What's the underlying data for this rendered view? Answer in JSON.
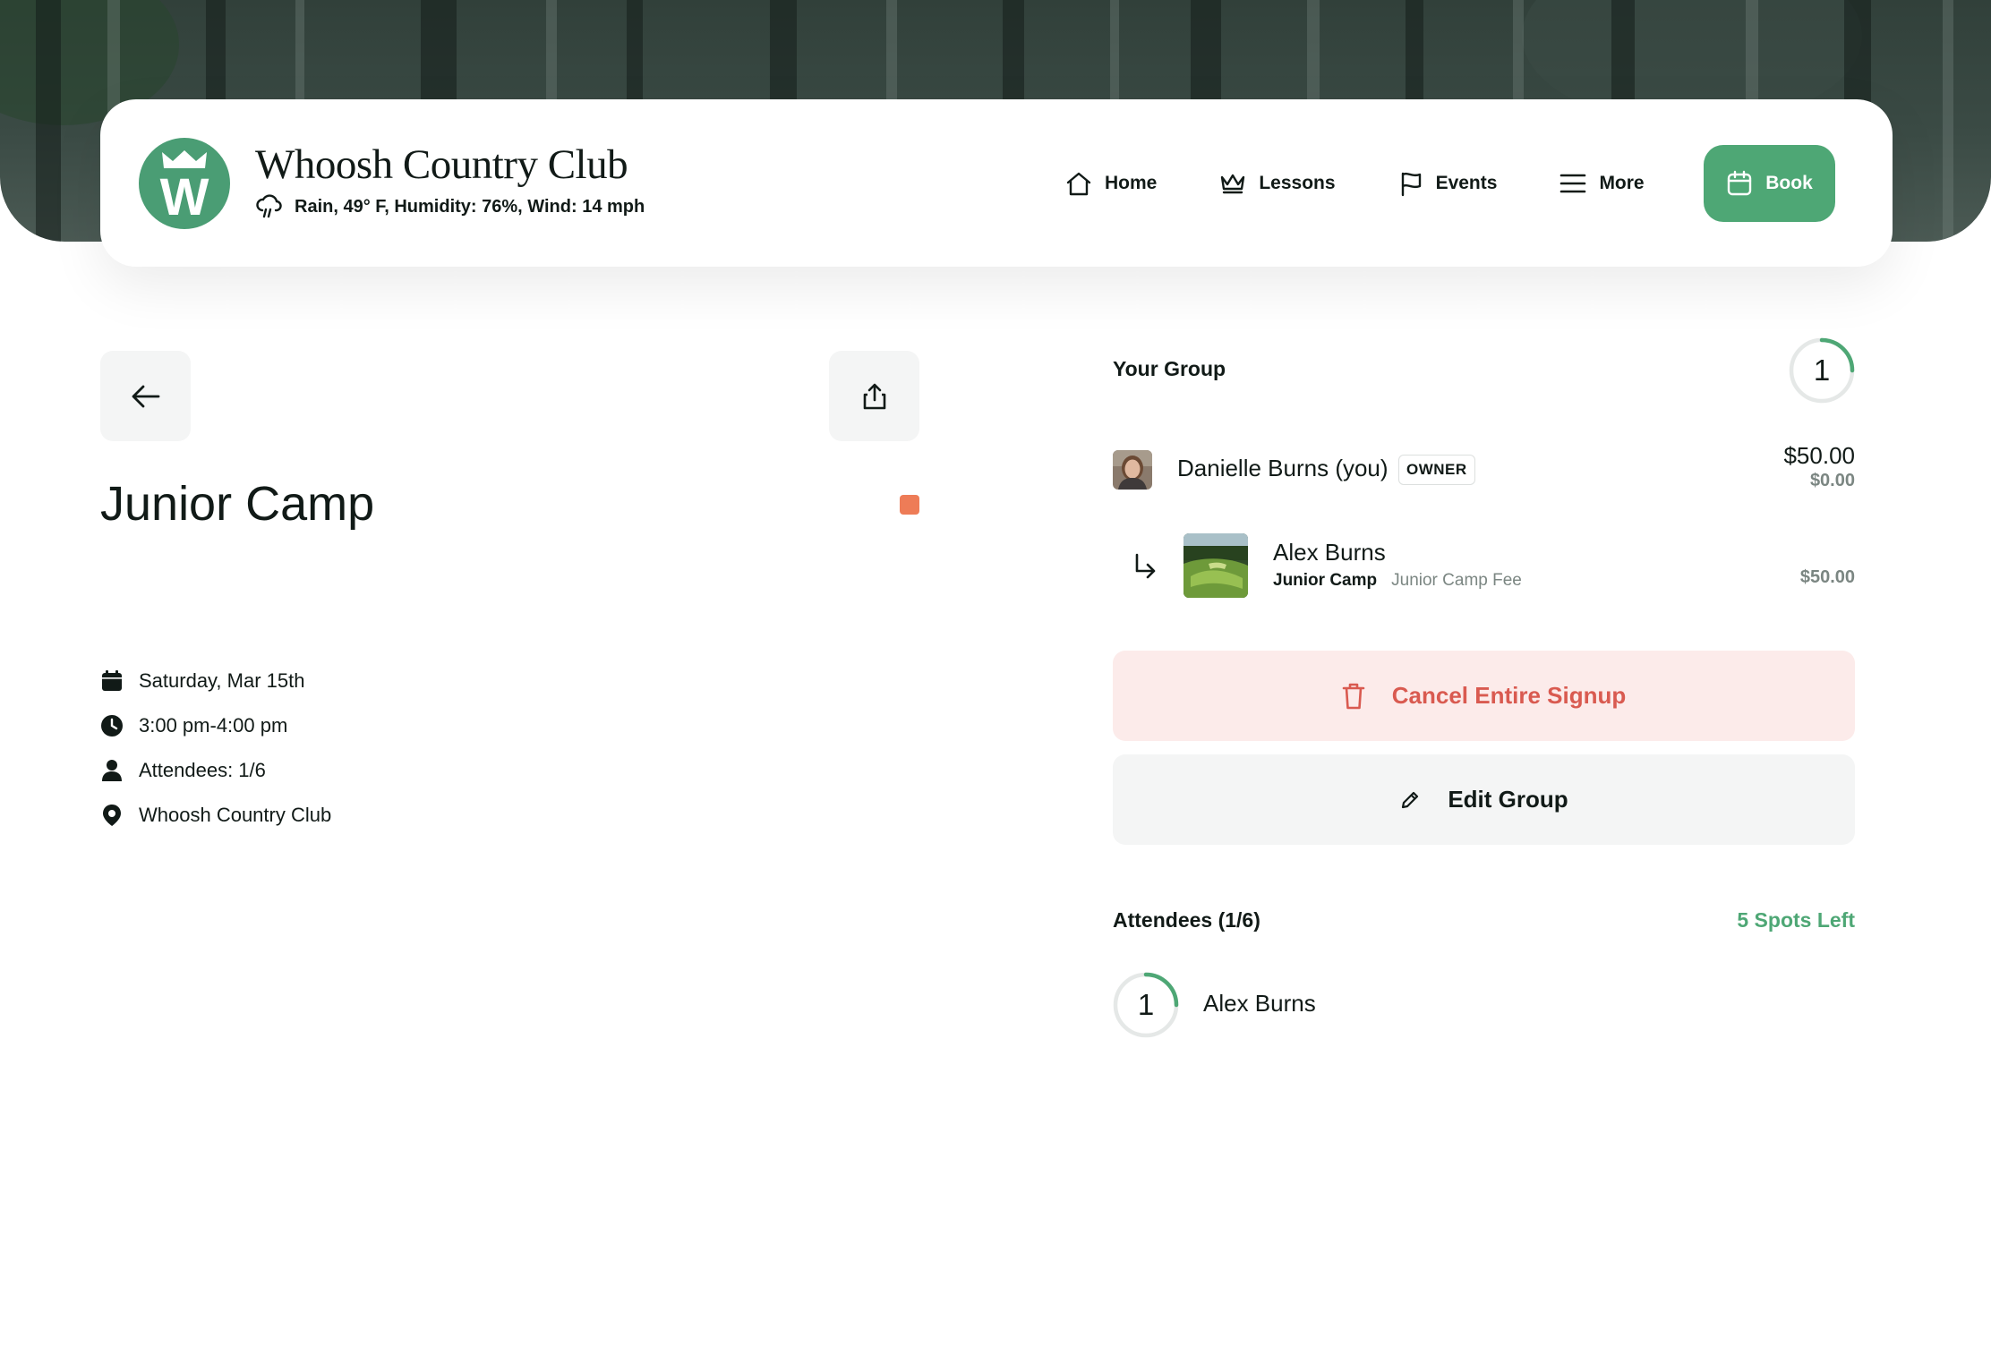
{
  "header": {
    "club_name": "Whoosh Country Club",
    "logo_letter": "W",
    "weather": "Rain, 49° F, Humidity: 76%, Wind: 14 mph",
    "nav": [
      {
        "label": "Home",
        "icon": "home-icon"
      },
      {
        "label": "Lessons",
        "icon": "crown-icon"
      },
      {
        "label": "Events",
        "icon": "flag-icon"
      },
      {
        "label": "More",
        "icon": "menu-icon"
      }
    ],
    "book_label": "Book"
  },
  "event": {
    "title": "Junior Camp",
    "color": "#ee7c57",
    "details": {
      "date": "Saturday, Mar 15th",
      "time": "3:00 pm-4:00 pm",
      "attendees": "Attendees: 1/6",
      "location": "Whoosh Country Club"
    }
  },
  "group": {
    "label": "Your Group",
    "count": "1",
    "owner": {
      "name": "Danielle Burns (you)",
      "badge": "OWNER",
      "price": "$50.00",
      "price_sub": "$0.00"
    },
    "member": {
      "name": "Alex Burns",
      "event": "Junior Camp",
      "fee": "Junior Camp Fee",
      "price": "$50.00"
    }
  },
  "actions": {
    "cancel_label": "Cancel Entire Signup",
    "edit_label": "Edit Group"
  },
  "attendees": {
    "label": "Attendees (1/6)",
    "spots_left": "5 Spots Left",
    "list": [
      {
        "number": "1",
        "name": "Alex Burns"
      }
    ]
  },
  "colors": {
    "brand_green": "#4ea775",
    "danger": "#d95a50",
    "danger_bg": "#fcebea"
  }
}
